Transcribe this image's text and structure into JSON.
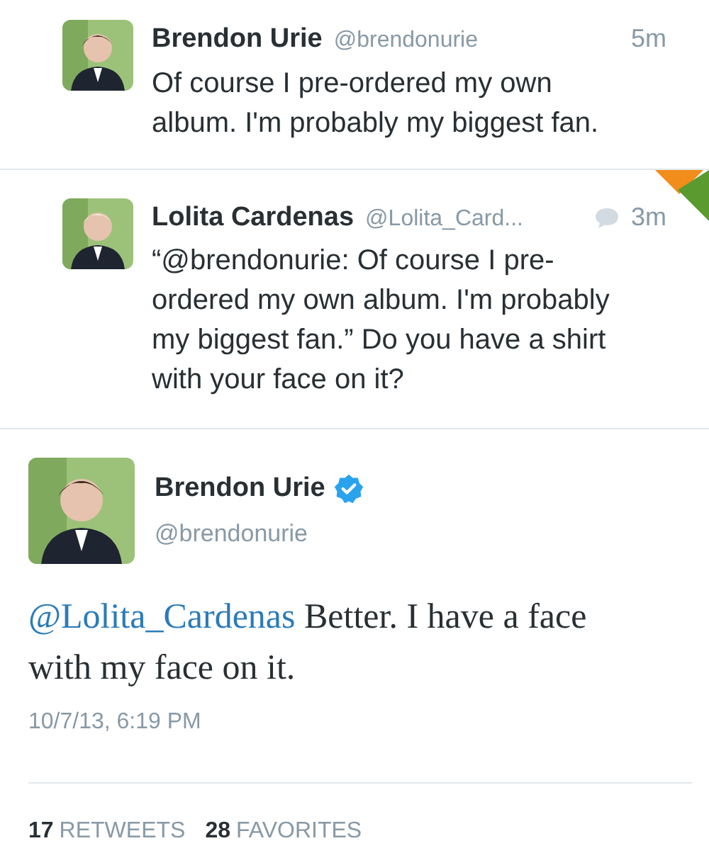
{
  "timeline": [
    {
      "name": "Brendon Urie",
      "handle": "@brendonurie",
      "time": "5m",
      "text": "Of course I pre-ordered my own album. I'm probably my biggest fan.",
      "is_reply": false,
      "retweeted": false,
      "favorited": false
    },
    {
      "name": "Lolita Cardenas",
      "handle": "@Lolita_Card...",
      "time": "3m",
      "text": "“@brendonurie: Of course I pre-ordered my own album. I'm probably my biggest fan.” Do you have a shirt with your face on it?",
      "is_reply": true,
      "retweeted": true,
      "favorited": true
    }
  ],
  "detail": {
    "name": "Brendon Urie",
    "verified": true,
    "handle": "@brendonurie",
    "mention": "@Lolita_Cardenas",
    "text": "Better. I have a face with my face on it.",
    "timestamp": "10/7/13, 6:19 PM",
    "stats": [
      {
        "count": "17",
        "label": "RETWEETS"
      },
      {
        "count": "28",
        "label": "FAVORITES"
      }
    ]
  }
}
